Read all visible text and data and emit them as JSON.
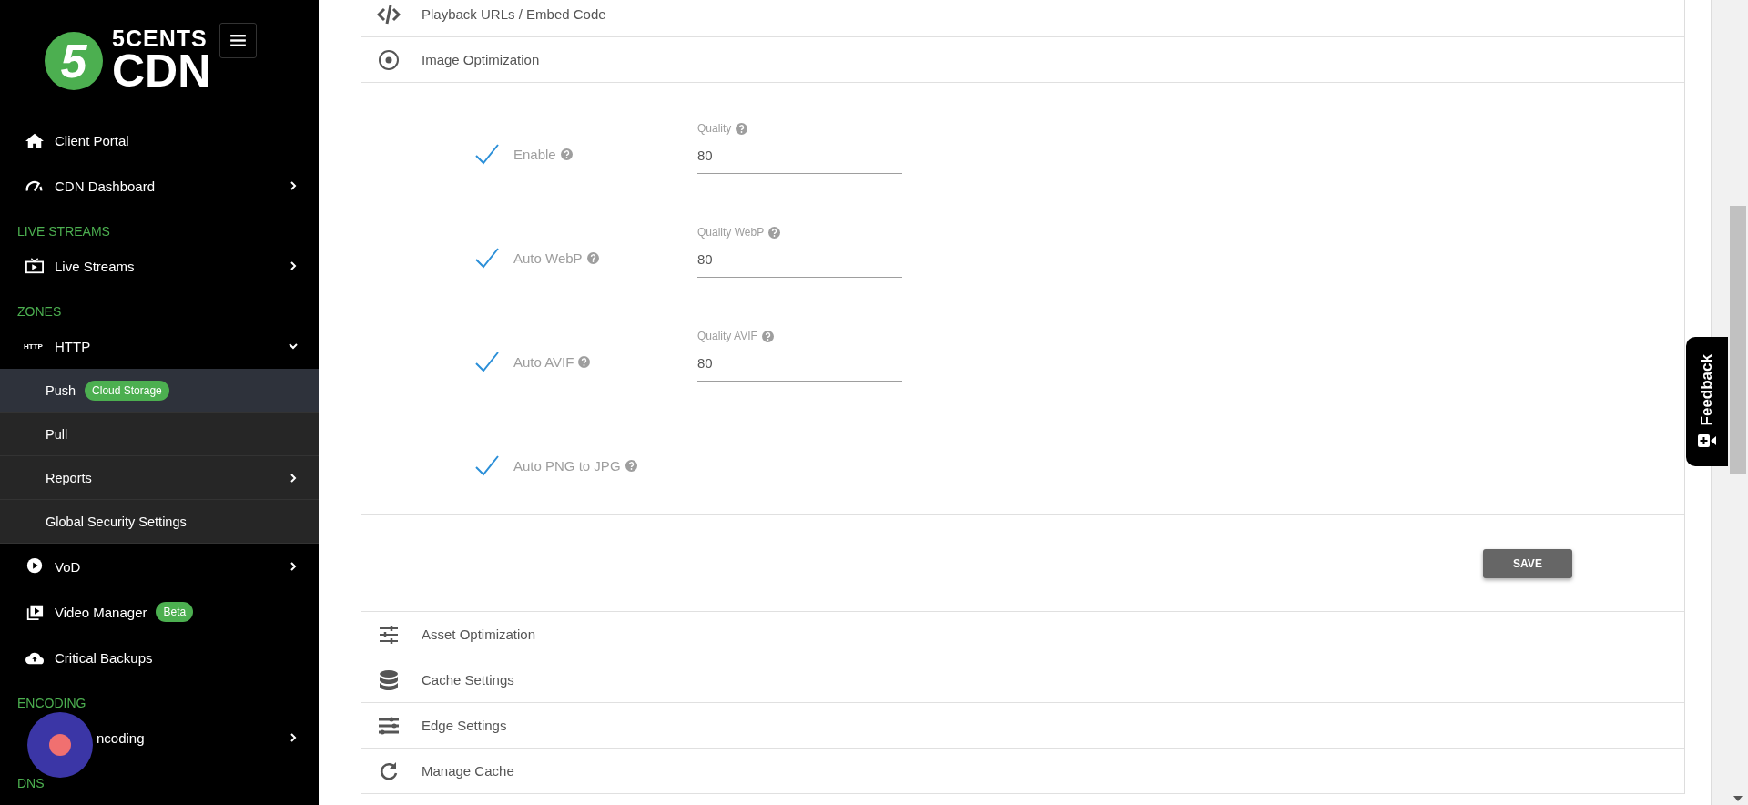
{
  "sidebar": {
    "logo": {
      "mark": "5",
      "line_1": "5CENTS",
      "line_2": "CDN"
    },
    "items": [
      {
        "kind": "link",
        "label": "Client Portal"
      },
      {
        "kind": "link",
        "label": "CDN Dashboard",
        "expanded": false
      },
      {
        "kind": "section",
        "label": "LIVE STREAMS"
      },
      {
        "kind": "link",
        "label": "Live Streams",
        "expanded": false
      },
      {
        "kind": "section",
        "label": "ZONES"
      },
      {
        "kind": "link",
        "label": "HTTP",
        "icon_text": "HTTP",
        "expanded": true,
        "children": [
          {
            "label": "Push",
            "selected": true,
            "badge": "Cloud Storage"
          },
          {
            "label": "Pull",
            "selected": false
          },
          {
            "label": "Reports",
            "selected": false,
            "expanded": false
          },
          {
            "label": "Global Security Settings",
            "selected": false
          }
        ]
      },
      {
        "kind": "link",
        "label": "VoD",
        "expanded": false
      },
      {
        "kind": "link",
        "label": "Video Manager",
        "badge": "Beta"
      },
      {
        "kind": "link",
        "label": "Critical Backups"
      },
      {
        "kind": "section",
        "label": "ENCODING"
      },
      {
        "kind": "link",
        "label": "ncoding",
        "expanded": false
      },
      {
        "kind": "section",
        "label": "DNS"
      }
    ]
  },
  "sections": [
    {
      "title": "Playback URLs / Embed Code"
    },
    {
      "title": "Image Optimization",
      "options": [
        {
          "label": "Enable",
          "checked": true,
          "field": {
            "label": "Quality",
            "value": "80"
          }
        },
        {
          "label": "Auto WebP",
          "checked": true,
          "field": {
            "label": "Quality WebP",
            "value": "80"
          }
        },
        {
          "label": "Auto AVIF",
          "checked": true,
          "field": {
            "label": "Quality AVIF",
            "value": "80"
          }
        },
        {
          "label": "Auto PNG to JPG",
          "checked": true
        }
      ],
      "save_button": "SAVE"
    },
    {
      "title": "Asset Optimization"
    },
    {
      "title": "Cache Settings"
    },
    {
      "title": "Edge Settings"
    },
    {
      "title": "Manage Cache"
    }
  ],
  "feedback": {
    "label": "Feedback"
  }
}
